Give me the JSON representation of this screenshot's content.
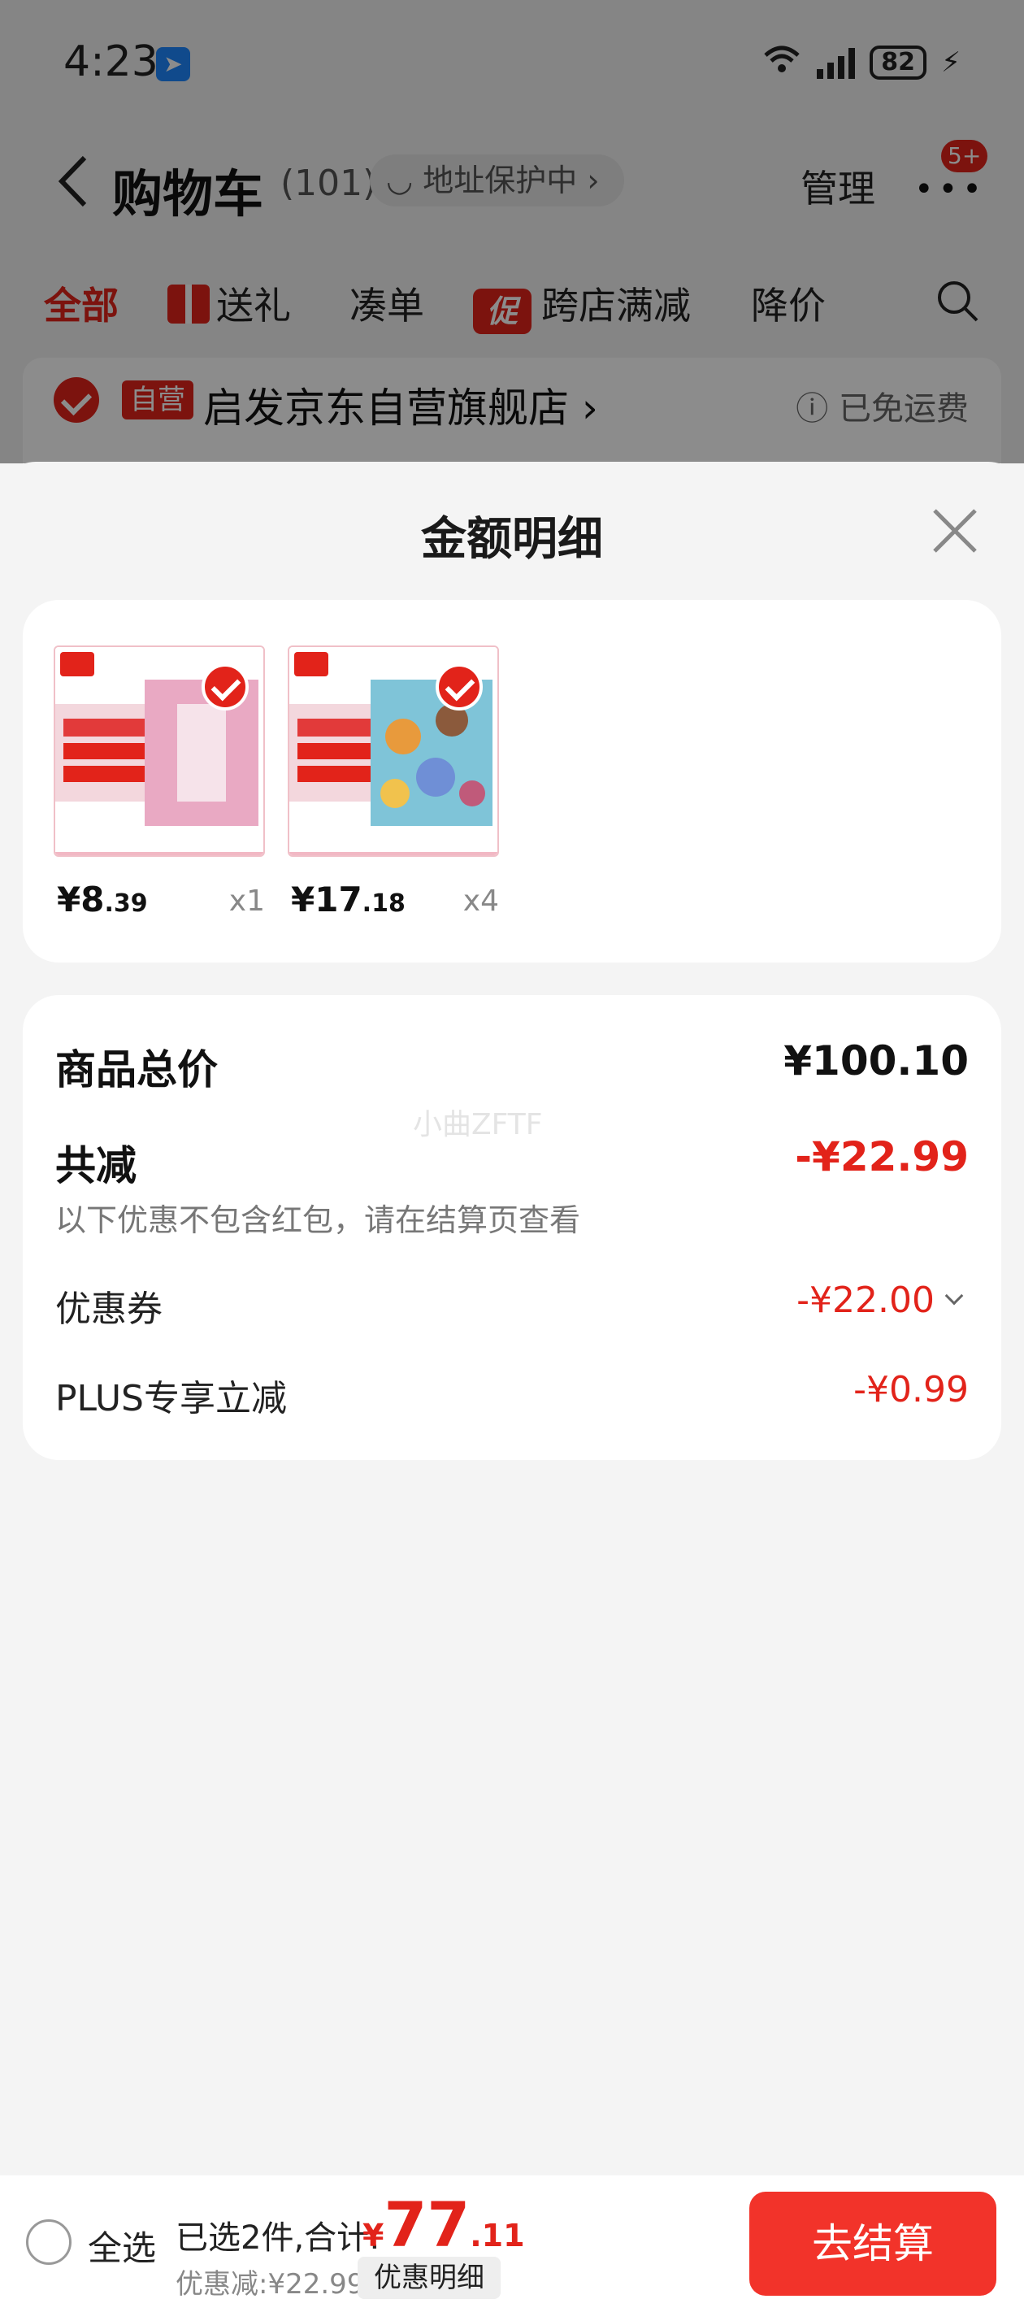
{
  "status_bar": {
    "time": "4:23",
    "network": "6",
    "battery": "82"
  },
  "top_bar": {
    "title": "购物车",
    "count": "(101)",
    "address_pill": "地址保护中",
    "manage_label": "管理",
    "message_badge": "5+"
  },
  "filter_tabs": [
    {
      "label": "全部"
    },
    {
      "label": "送礼"
    },
    {
      "label": "凑单"
    },
    {
      "label": "跨店满减",
      "icon_text": "促"
    },
    {
      "label": "降价"
    }
  ],
  "store": {
    "tag": "自营",
    "name": "启发京东自营旗舰店",
    "shipping": "已免运费"
  },
  "sheet": {
    "title": "金额明细",
    "products": [
      {
        "price_int": "¥8",
        "price_dec": ".39",
        "qty": "x1"
      },
      {
        "price_int": "¥17",
        "price_dec": ".18",
        "qty": "x4"
      }
    ],
    "summary": {
      "goods_total_label": "商品总价",
      "goods_total_value": "¥100.10",
      "watermark": "小曲ZFTF",
      "discount_total_label": "共减",
      "discount_total_value": "-¥22.99",
      "discount_note": "以下优惠不包含红包，请在结算页查看",
      "coupon_label": "优惠券",
      "coupon_value": "-¥22.00",
      "plus_label": "PLUS专享立减",
      "plus_value": "-¥0.99"
    }
  },
  "bottom_bar": {
    "select_all_label": "全选",
    "selected_text": "已选2件,合计:",
    "total_currency": "¥",
    "total_int": "77",
    "total_dec": ".11",
    "discount_text": "优惠减:¥22.99",
    "discount_detail_label": "优惠明细",
    "checkout_label": "去结算"
  },
  "colors": {
    "accent": "#e2231a",
    "checkout": "#f2332a"
  },
  "icons": [
    "back-arrow-icon",
    "more-dots-icon",
    "gift-icon",
    "promo-icon",
    "search-icon",
    "close-icon",
    "check-icon",
    "chevron-down-icon",
    "radio-icon"
  ]
}
